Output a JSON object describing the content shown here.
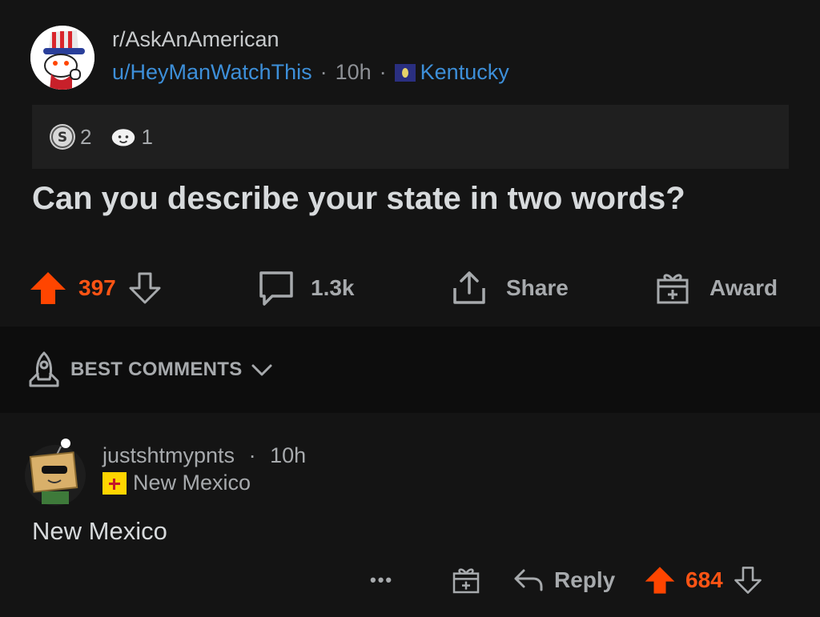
{
  "post": {
    "subreddit": "r/AskAnAmerican",
    "author": "u/HeyManWatchThis",
    "age": "10h",
    "author_flair": "Kentucky",
    "awards": [
      {
        "icon": "silver-award-icon",
        "count": "2"
      },
      {
        "icon": "wholesome-award-icon",
        "count": "1"
      }
    ],
    "title": "Can you describe your state in two words?",
    "vote_count": "397",
    "comment_count": "1.3k",
    "share_label": "Share",
    "award_label": "Award"
  },
  "sort": {
    "label": "BEST COMMENTS"
  },
  "comment": {
    "author": "justshtmypnts",
    "age": "10h",
    "flair": "New Mexico",
    "body": "New Mexico",
    "reply_label": "Reply",
    "vote_count": "684",
    "more_label": "•••"
  },
  "colors": {
    "upvote": "#ff4500",
    "link": "#3d8fd9",
    "background": "#141414"
  }
}
